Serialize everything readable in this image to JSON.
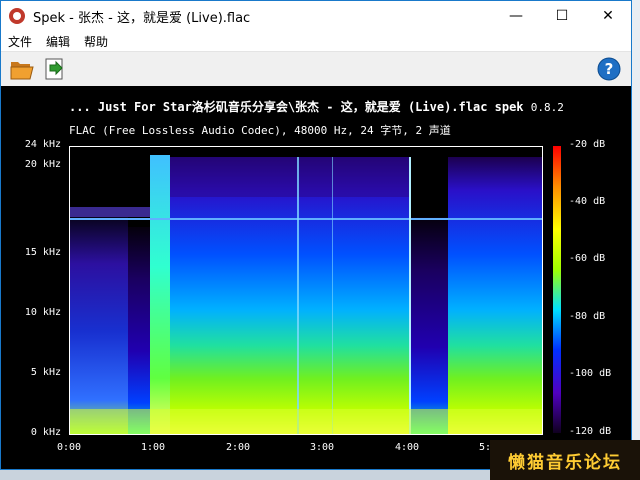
{
  "window": {
    "title": "Spek - 张杰 - 这，就是爱 (Live).flac",
    "minimize": "—",
    "maximize": "☐",
    "close": "✕"
  },
  "menu": [
    "文件",
    "编辑",
    "帮助"
  ],
  "toolbar": {
    "open_icon": "open-folder-icon",
    "save_icon": "save-image-icon",
    "help_icon": "help-icon"
  },
  "spectrogram": {
    "heading": "... Just For Star洛杉矶音乐分享会\\张杰 - 这，就是爱 (Live).flac spek",
    "version": "0.8.2",
    "info": "FLAC (Free Lossless Audio Codec), 48000 Hz, 24 字节, 2 声道",
    "freq_ticks": [
      "24 kHz",
      "20 kHz",
      "15 kHz",
      "10 kHz",
      "5 kHz",
      "0 kHz"
    ],
    "time_ticks": [
      "0:00",
      "1:00",
      "2:00",
      "3:00",
      "4:00",
      "5:"
    ],
    "db_ticks": [
      "-20 dB",
      "-40 dB",
      "-60 dB",
      "-80 dB",
      "-100 dB",
      "-120 dB"
    ]
  },
  "watermark": "懒猫音乐论坛"
}
